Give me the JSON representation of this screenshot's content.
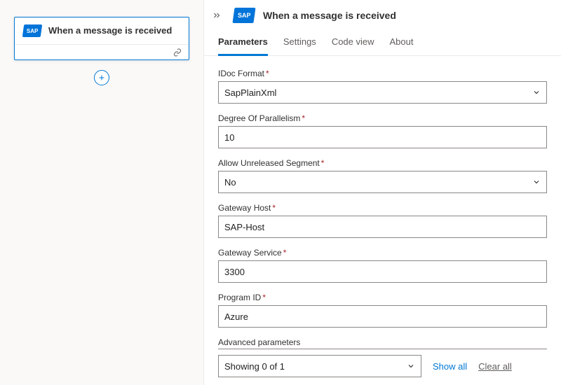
{
  "canvas": {
    "node_title": "When a message is received",
    "logo_text": "SAP"
  },
  "panel": {
    "title": "When a message is received",
    "logo_text": "SAP",
    "tabs": [
      {
        "label": "Parameters",
        "active": true
      },
      {
        "label": "Settings",
        "active": false
      },
      {
        "label": "Code view",
        "active": false
      },
      {
        "label": "About",
        "active": false
      }
    ]
  },
  "fields": {
    "idoc_format": {
      "label": "IDoc Format",
      "value": "SapPlainXml"
    },
    "parallelism": {
      "label": "Degree Of Parallelism",
      "value": "10"
    },
    "allow_unreleased": {
      "label": "Allow Unreleased Segment",
      "value": "No"
    },
    "gateway_host": {
      "label": "Gateway Host",
      "value": "SAP-Host"
    },
    "gateway_service": {
      "label": "Gateway Service",
      "value": "3300"
    },
    "program_id": {
      "label": "Program ID",
      "value": "Azure"
    }
  },
  "advanced": {
    "heading": "Advanced parameters",
    "showing": "Showing 0 of 1",
    "show_all": "Show all",
    "clear_all": "Clear all"
  }
}
